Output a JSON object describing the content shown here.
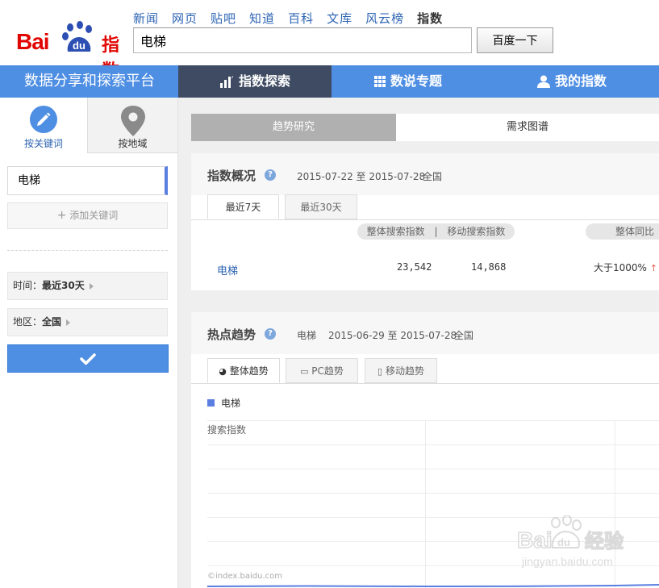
{
  "brand": {
    "logo_text_bai": "Bai",
    "logo_text_du": "du",
    "logo_text_zhi": "指数"
  },
  "topnav": [
    "新闻",
    "网页",
    "贴吧",
    "知道",
    "百科",
    "文库",
    "风云榜",
    "指数"
  ],
  "search": {
    "value": "电梯",
    "button": "百度一下"
  },
  "navbar": {
    "platform": "数据分享和探索平台",
    "items": [
      "指数探索",
      "数说专题",
      "我的指数"
    ]
  },
  "sidebar": {
    "tabs": [
      "按关键词",
      "按地域"
    ],
    "keyword": "电梯",
    "add_keyword": "添加关键词",
    "time_label": "时间：",
    "time_value": "最近30天",
    "area_label": "地区：",
    "area_value": "全国"
  },
  "main": {
    "tabs": [
      "趋势研究",
      "需求图谱"
    ],
    "overview": {
      "title": "指数概况",
      "range": "2015-07-22 至 2015-07-28",
      "region": "全国",
      "subtabs": [
        "最近7天",
        "最近30天"
      ],
      "col_overall": "整体搜索指数",
      "col_sep": "|",
      "col_mobile": "移动搜索指数",
      "col_yoy": "整体同比",
      "row": {
        "keyword": "电梯",
        "overall": "23,542",
        "mobile": "14,868",
        "yoy": "大于1000%",
        "yoy_arrow": "↑"
      }
    },
    "hot": {
      "title": "热点趋势",
      "keyword": "电梯",
      "range": "2015-06-29 至 2015-07-28",
      "region": "全国",
      "subtabs": [
        "整体趋势",
        "PC趋势",
        "移动趋势"
      ],
      "legend": "电梯",
      "ylabel": "搜索指数",
      "copyright": "©index.baidu.com"
    }
  },
  "watermark": {
    "brand": "Bai",
    "brand2": "du",
    "text": "经验",
    "url": "jingyan.baidu.com"
  },
  "colors": {
    "accent": "#4e8ee3",
    "dark_tab": "#3e4b62",
    "brand_red": "#e10601",
    "series": "#5b7fe0"
  }
}
